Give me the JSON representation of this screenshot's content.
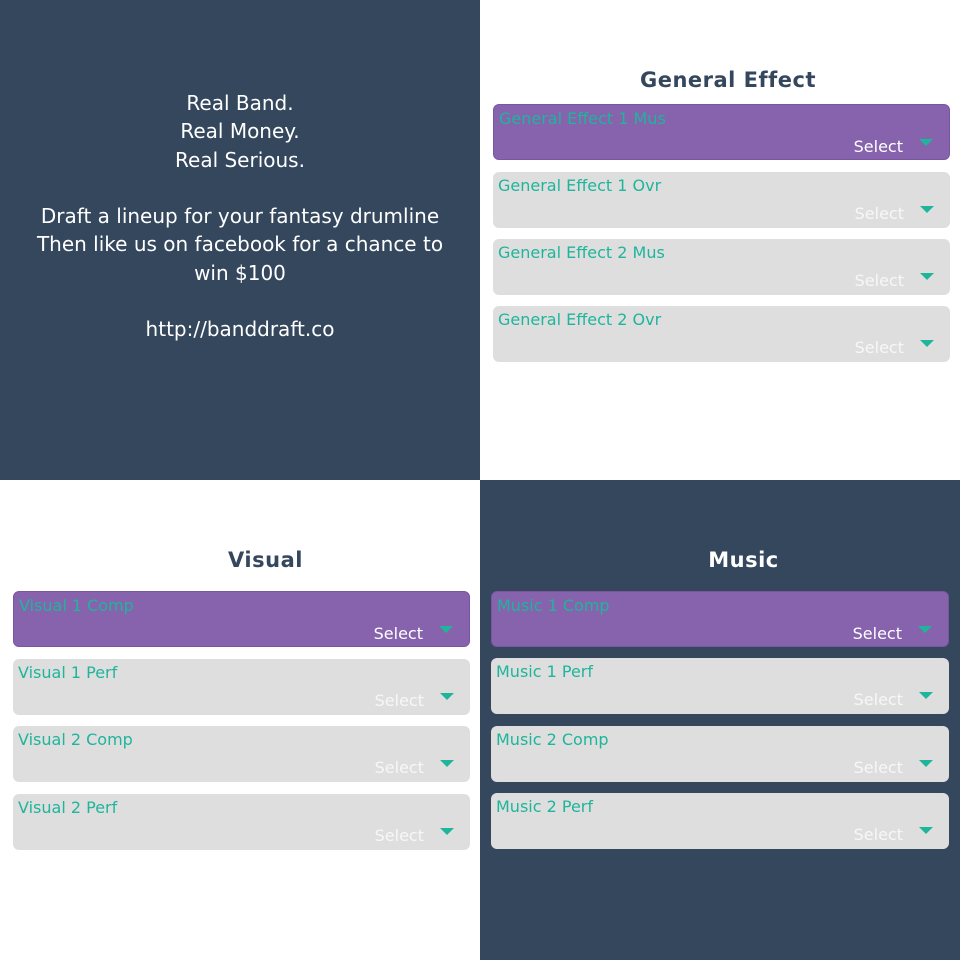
{
  "promo": {
    "line1": "Real Band.",
    "line2": "Real Money.",
    "line3": "Real Serious.",
    "line4": "Draft a lineup for your fantasy drumline",
    "line5": "Then like us on facebook for a chance to",
    "line6": "win $100",
    "link": "http://banddraft.co"
  },
  "general_effect": {
    "title": "General Effect",
    "items": [
      {
        "label": "General Effect 1 Mus",
        "value": "Select"
      },
      {
        "label": "General Effect 1 Ovr",
        "value": "Select"
      },
      {
        "label": "General Effect 2 Mus",
        "value": "Select"
      },
      {
        "label": "General Effect 2 Ovr",
        "value": "Select"
      }
    ]
  },
  "visual": {
    "title": "Visual",
    "items": [
      {
        "label": "Visual 1 Comp",
        "value": "Select"
      },
      {
        "label": "Visual 1 Perf",
        "value": "Select"
      },
      {
        "label": "Visual 2 Comp",
        "value": "Select"
      },
      {
        "label": "Visual 2 Perf",
        "value": "Select"
      }
    ]
  },
  "music": {
    "title": "Music",
    "items": [
      {
        "label": "Music 1 Comp",
        "value": "Select"
      },
      {
        "label": "Music 1 Perf",
        "value": "Select"
      },
      {
        "label": "Music 2 Comp",
        "value": "Select"
      },
      {
        "label": "Music 2 Perf",
        "value": "Select"
      }
    ]
  },
  "colors": {
    "navy": "#34475d",
    "purple_active": "#8762ad",
    "teal_accent": "#1eb59b",
    "inactive_box": "#dedede"
  },
  "icons": {
    "dropdown": "chevron-down-icon"
  }
}
